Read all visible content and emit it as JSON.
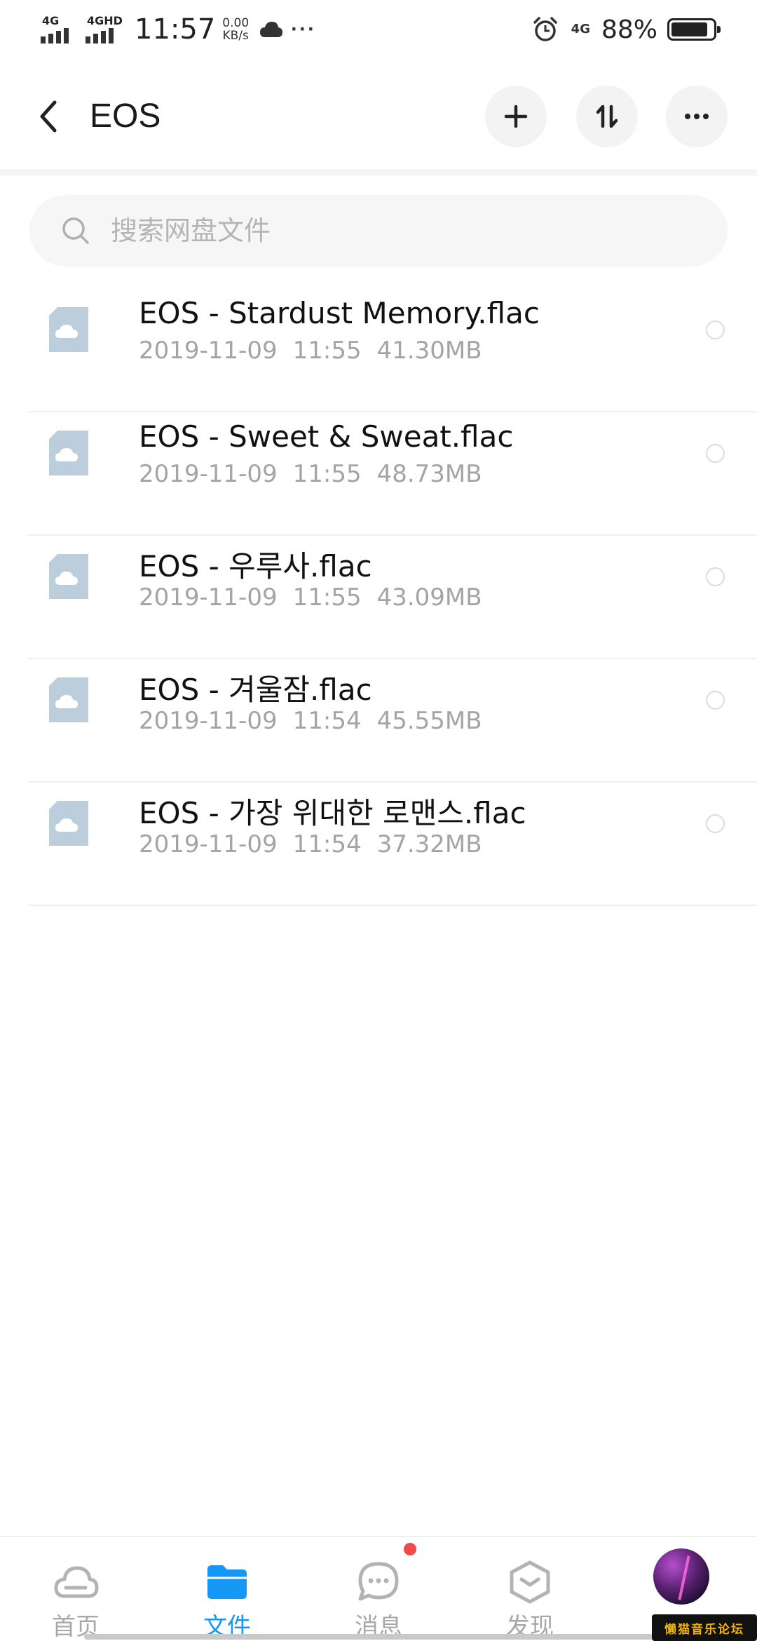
{
  "status_bar": {
    "sim1": "4G",
    "sim2": "4GHD",
    "time": "11:57",
    "speed_value": "0.00",
    "speed_unit": "KB/s",
    "network": "4G",
    "battery_percent": "88%",
    "battery_level": 0.88,
    "icons": [
      "signal-icon",
      "cloud-icon",
      "more-dots-icon",
      "alarm-icon",
      "battery-icon"
    ]
  },
  "header": {
    "title": "EOS",
    "icons": [
      "back-arrow-icon",
      "plus-icon",
      "sort-icon",
      "more-icon"
    ]
  },
  "search": {
    "placeholder": "搜索网盘文件",
    "value": ""
  },
  "files": [
    {
      "name": "EOS - Stardust Memory.flac",
      "date": "2019-11-09",
      "time": "11:55",
      "size": "41.30MB"
    },
    {
      "name": "EOS - Sweet & Sweat.flac",
      "date": "2019-11-09",
      "time": "11:55",
      "size": "48.73MB"
    },
    {
      "name": "EOS - 우루사.flac",
      "date": "2019-11-09",
      "time": "11:55",
      "size": "43.09MB"
    },
    {
      "name": "EOS - 겨울잠.flac",
      "date": "2019-11-09",
      "time": "11:54",
      "size": "45.55MB"
    },
    {
      "name": "EOS - 가장 위대한 로맨스.flac",
      "date": "2019-11-09",
      "time": "11:54",
      "size": "37.32MB"
    }
  ],
  "bottom_nav": {
    "items": [
      {
        "label": "首页",
        "icon": "cloud-icon",
        "active": false
      },
      {
        "label": "文件",
        "icon": "folder-icon",
        "active": true
      },
      {
        "label": "消息",
        "icon": "chat-icon",
        "active": false
      },
      {
        "label": "发现",
        "icon": "cube-icon",
        "active": false
      },
      {
        "label": "",
        "icon": "avatar",
        "active": false
      }
    ]
  },
  "colors": {
    "accent": "#1497f5",
    "badge": "#f04a4a",
    "file_icon": "#bccddb",
    "inactive": "#a8a8a8"
  },
  "watermark": "懒猫音乐论坛"
}
